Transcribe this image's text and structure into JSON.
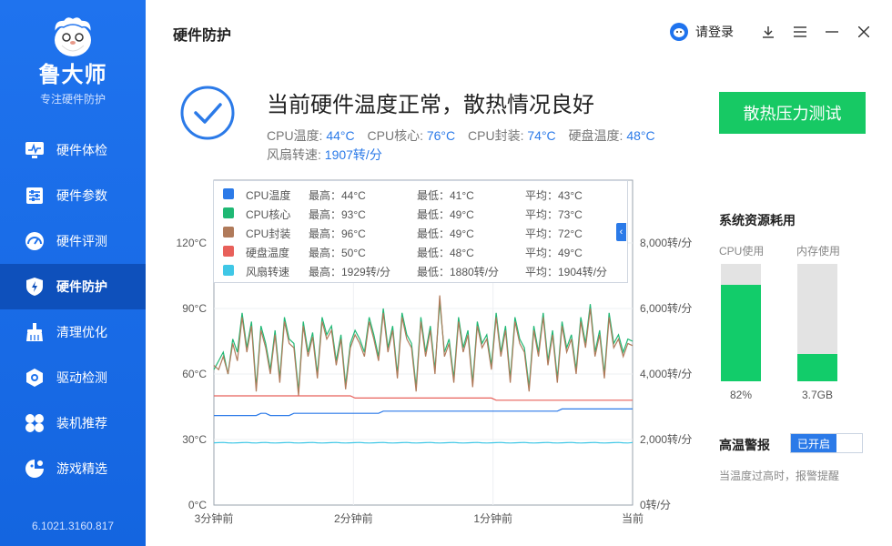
{
  "sidebar": {
    "brand": "鲁大师",
    "tagline": "专注硬件防护",
    "items": [
      {
        "label": "硬件体检",
        "icon": "monitor-icon"
      },
      {
        "label": "硬件参数",
        "icon": "sliders-icon"
      },
      {
        "label": "硬件评测",
        "icon": "gauge-icon"
      },
      {
        "label": "硬件防护",
        "icon": "shield-icon",
        "active": true
      },
      {
        "label": "清理优化",
        "icon": "broom-icon"
      },
      {
        "label": "驱动检测",
        "icon": "gear-icon"
      },
      {
        "label": "装机推荐",
        "icon": "grid-icon"
      },
      {
        "label": "游戏精选",
        "icon": "gamepad-icon"
      }
    ],
    "version": "6.1021.3160.817"
  },
  "header": {
    "title": "硬件防护",
    "login_label": "请登录"
  },
  "status": {
    "title": "当前硬件温度正常，散热情况良好",
    "temps": [
      {
        "label": "CPU温度:",
        "value": "44°C"
      },
      {
        "label": "CPU核心:",
        "value": "76°C"
      },
      {
        "label": "CPU封装:",
        "value": "74°C"
      },
      {
        "label": "硬盘温度:",
        "value": "48°C"
      }
    ],
    "fan_label": "风扇转速:",
    "fan_value": "1907转/分",
    "stress_button": "散热压力测试"
  },
  "chart_data": {
    "type": "line",
    "x_ticks": [
      "3分钟前",
      "2分钟前",
      "1分钟前",
      "当前"
    ],
    "y_left_ticks": [
      "0°C",
      "30°C",
      "60°C",
      "90°C",
      "120°C"
    ],
    "y_left_range": [
      0,
      120
    ],
    "y_right_ticks": [
      "0转/分",
      "2,000转/分",
      "4,000转/分",
      "6,000转/分",
      "8,000转/分"
    ],
    "y_right_range": [
      0,
      8000
    ],
    "grid": true,
    "series": [
      {
        "name": "CPU温度",
        "color": "#2b7ae8",
        "axis": "left",
        "max": "最高：44°C",
        "min": "最低：41°C",
        "avg": "平均：43°C",
        "values": [
          41,
          41,
          41,
          41,
          41,
          41,
          41,
          41,
          41,
          41,
          42,
          42,
          41,
          41,
          41,
          41,
          41,
          42,
          42,
          42,
          42,
          42,
          42,
          42,
          42,
          42,
          42,
          42,
          42,
          42,
          42,
          42,
          42,
          42,
          42,
          42,
          43,
          43,
          43,
          43,
          43,
          43,
          43,
          43,
          43,
          43,
          43,
          43,
          43,
          43,
          43,
          43,
          43,
          43,
          43,
          43,
          43,
          43,
          43,
          43,
          43,
          43,
          43,
          43,
          43,
          43,
          43,
          43,
          43,
          43,
          43,
          43,
          43,
          43,
          44,
          44,
          44,
          44,
          44,
          44,
          44,
          44,
          44,
          44,
          44,
          44,
          44,
          44,
          44,
          44
        ]
      },
      {
        "name": "CPU核心",
        "color": "#1fb874",
        "axis": "left",
        "max": "最高：93°C",
        "min": "最低：49°C",
        "avg": "平均：73°C",
        "values": [
          62,
          66,
          70,
          60,
          76,
          70,
          88,
          72,
          84,
          54,
          82,
          74,
          62,
          80,
          58,
          86,
          76,
          74,
          52,
          84,
          70,
          79,
          60,
          86,
          78,
          82,
          66,
          78,
          55,
          74,
          80,
          76,
          70,
          86,
          78,
          68,
          90,
          72,
          82,
          60,
          88,
          78,
          74,
          54,
          86,
          70,
          82,
          62,
          93,
          70,
          76,
          58,
          86,
          72,
          80,
          56,
          84,
          74,
          78,
          64,
          88,
          70,
          82,
          58,
          86,
          76,
          72,
          54,
          82,
          70,
          88,
          66,
          80,
          58,
          84,
          72,
          78,
          62,
          86,
          74,
          92,
          70,
          80,
          60,
          88,
          74,
          78,
          70,
          76,
          75
        ]
      },
      {
        "name": "CPU封装",
        "color": "#b07a5a",
        "axis": "left",
        "max": "最高：96°C",
        "min": "最低：49°C",
        "avg": "平均：72°C",
        "values": [
          64,
          62,
          68,
          60,
          74,
          66,
          86,
          70,
          82,
          52,
          80,
          72,
          60,
          78,
          56,
          84,
          74,
          72,
          50,
          82,
          68,
          77,
          58,
          84,
          76,
          80,
          64,
          76,
          53,
          72,
          78,
          74,
          68,
          84,
          76,
          66,
          88,
          70,
          80,
          58,
          86,
          76,
          72,
          52,
          84,
          68,
          80,
          60,
          96,
          68,
          74,
          56,
          84,
          70,
          78,
          54,
          82,
          72,
          76,
          62,
          86,
          68,
          80,
          56,
          84,
          74,
          70,
          52,
          80,
          68,
          86,
          64,
          78,
          56,
          82,
          70,
          76,
          60,
          84,
          72,
          90,
          68,
          78,
          58,
          86,
          72,
          76,
          68,
          74,
          73
        ]
      },
      {
        "name": "硬盘温度",
        "color": "#e8605a",
        "axis": "left",
        "max": "最高：50°C",
        "min": "最低：48°C",
        "avg": "平均：49°C",
        "values": [
          50,
          50,
          50,
          50,
          50,
          50,
          50,
          50,
          50,
          50,
          50,
          50,
          50,
          50,
          50,
          50,
          50,
          50,
          50,
          50,
          50,
          50,
          50,
          50,
          50,
          50,
          50,
          50,
          50,
          50,
          49,
          49,
          49,
          49,
          49,
          49,
          49,
          49,
          49,
          49,
          49,
          49,
          49,
          49,
          49,
          49,
          49,
          49,
          49,
          49,
          49,
          49,
          49,
          49,
          49,
          49,
          49,
          49,
          49,
          49,
          48,
          48,
          48,
          48,
          48,
          48,
          48,
          48,
          48,
          48,
          48,
          48,
          48,
          48,
          48,
          48,
          48,
          48,
          48,
          48,
          48,
          48,
          48,
          48,
          48,
          48,
          48,
          48,
          48,
          48
        ]
      },
      {
        "name": "风扇转速",
        "color": "#3fc7e6",
        "axis": "right",
        "max": "最高：1929转/分",
        "min": "最低：1880转/分",
        "avg": "平均：1904转/分",
        "values": [
          1900,
          1905,
          1910,
          1900,
          1895,
          1900,
          1905,
          1910,
          1900,
          1895,
          1905,
          1910,
          1900,
          1895,
          1900,
          1905,
          1910,
          1900,
          1895,
          1900,
          1905,
          1910,
          1900,
          1895,
          1900,
          1905,
          1910,
          1900,
          1895,
          1900,
          1905,
          1910,
          1900,
          1895,
          1900,
          1905,
          1910,
          1900,
          1895,
          1900,
          1905,
          1910,
          1900,
          1895,
          1900,
          1905,
          1910,
          1900,
          1895,
          1900,
          1905,
          1910,
          1900,
          1895,
          1900,
          1905,
          1910,
          1900,
          1895,
          1900,
          1905,
          1910,
          1900,
          1895,
          1900,
          1905,
          1910,
          1900,
          1895,
          1900,
          1905,
          1910,
          1900,
          1895,
          1900,
          1905,
          1910,
          1900,
          1895,
          1900,
          1905,
          1910,
          1900,
          1895,
          1900,
          1905,
          1910,
          1900,
          1895,
          1907
        ]
      }
    ]
  },
  "resources": {
    "title": "系统资源耗用",
    "cpu_label": "CPU使用",
    "cpu_value": "82%",
    "cpu_fraction": 0.82,
    "mem_label": "内存使用",
    "mem_value": "3.7GB",
    "mem_fraction": 0.23
  },
  "alarm": {
    "title": "高温警报",
    "toggle_label": "已开启",
    "desc": "当温度过高时，报警提醒"
  }
}
